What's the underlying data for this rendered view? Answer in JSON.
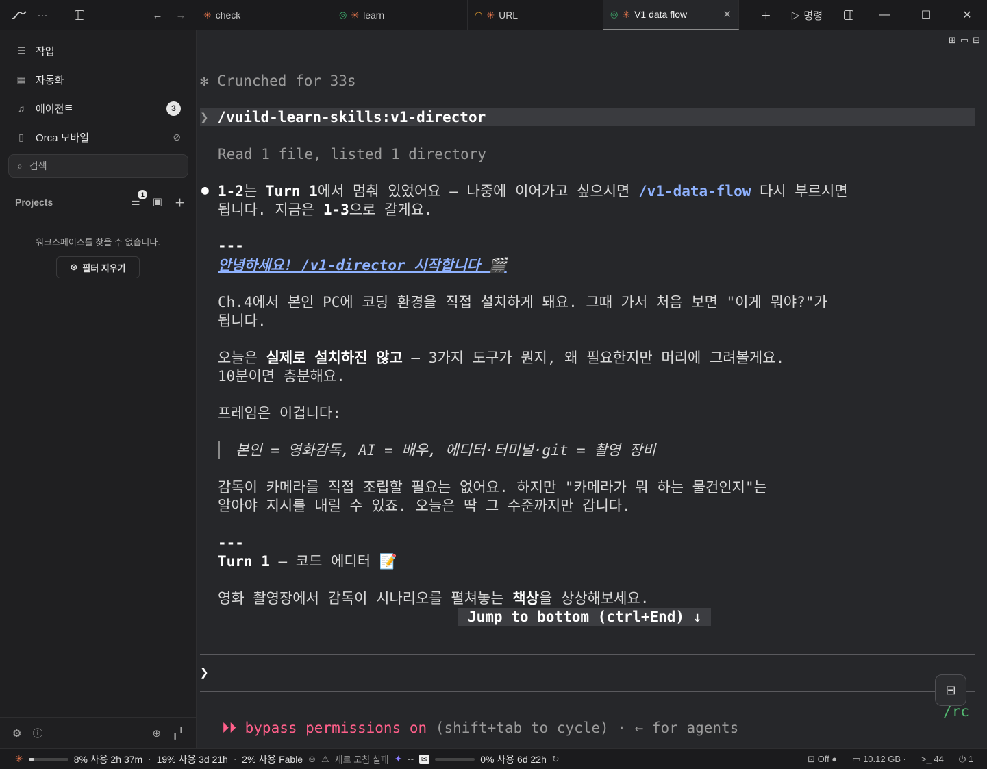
{
  "titlebar": {
    "tabs": [
      {
        "label": "check",
        "status": "none"
      },
      {
        "label": "learn",
        "status": "done"
      },
      {
        "label": "URL",
        "status": "running"
      },
      {
        "label": "V1 data flow",
        "status": "done",
        "active": true
      }
    ],
    "command_label": "명령"
  },
  "sidebar": {
    "nav": [
      {
        "label": "작업"
      },
      {
        "label": "자동화"
      },
      {
        "label": "에이전트",
        "badge": "3"
      },
      {
        "label": "Orca 모바일"
      }
    ],
    "search_placeholder": "검색",
    "projects_label": "Projects",
    "projects_filter_badge": "1",
    "empty_message": "워크스페이스를 찾을 수 없습니다.",
    "clear_filter_label": "필터 지우기"
  },
  "terminal": {
    "crunched": "Crunched for 33s",
    "command": "/vuild-learn-skills:v1-director",
    "read_info": "Read 1 file, listed 1 directory",
    "p1_a": "1-2",
    "p1_b": "는 ",
    "p1_c": "Turn 1",
    "p1_d": "에서 멈춰 있었어요 — 나중에 이어가고 싶으시면 ",
    "p1_link": "/v1-data-flow",
    "p1_e": " 다시 부르시면",
    "p1_line2_a": "됩니다. 지금은 ",
    "p1_line2_b": "1-3",
    "p1_line2_c": "으로 갈게요.",
    "divider": "---",
    "greet_a": "안녕하세요! ",
    "greet_b": "/v1-director",
    "greet_c": " 시작합니다 🎬",
    "p2_line1": "Ch.4에서 본인 PC에 코딩 환경을 직접 설치하게 돼요. 그때 가서 처음 보면 \"이게 뭐야?\"가",
    "p2_line2": "됩니다.",
    "p3_a": "오늘은 ",
    "p3_b": "실제로 설치하진 않고",
    "p3_c": " — 3가지 도구가 뭔지, 왜 필요한지만 머리에 그려볼게요.",
    "p3_line2": "10분이면 충분해요.",
    "p4": "프레임은 이겁니다:",
    "quote": "본인 = 영화감독, AI = 배우, 에디터·터미널·git = 촬영 장비",
    "p5_line1": "감독이 카메라를 직접 조립할 필요는 없어요. 하지만 \"카메라가 뭐 하는 물건인지\"는",
    "p5_line2": "알아야 지시를 내릴 수 있죠. 오늘은 딱 그 수준까지만 갑니다.",
    "turn_a": "Turn 1",
    "turn_b": " — 코드 에디터 📝",
    "p6_a": "영화 촬영장에서 감독이 시나리오를 펼쳐놓는 ",
    "p6_b": "책상",
    "p6_c": "을 상상해보세요.",
    "jump": "Jump to bottom (ctrl+End) ↓",
    "prompt": "❯",
    "bypass_on": "⏵⏵ bypass permissions on",
    "bypass_rest": " (shift+tab to cycle) · ← for agents",
    "rc": "/rc"
  },
  "statusbar": {
    "usage1": "8% 사용 2h 37m",
    "usage1_pct": 0.08,
    "usage2": "19% 사용 3d 21h",
    "usage3": "2% 사용 Fable",
    "fix_fail": "새로 고침 실패",
    "dash": "--",
    "usage4": "0% 사용 6d 22h",
    "usage4_pct": 0.0,
    "off": "Off",
    "memory": "10.12 GB",
    "terminals": "44",
    "ports": "1"
  },
  "colors": {
    "accent_star": "#e8774d",
    "link": "#8fb2ff",
    "bypass": "#ff5f8a",
    "rc": "#52b870",
    "ok": "#3fb06f"
  }
}
